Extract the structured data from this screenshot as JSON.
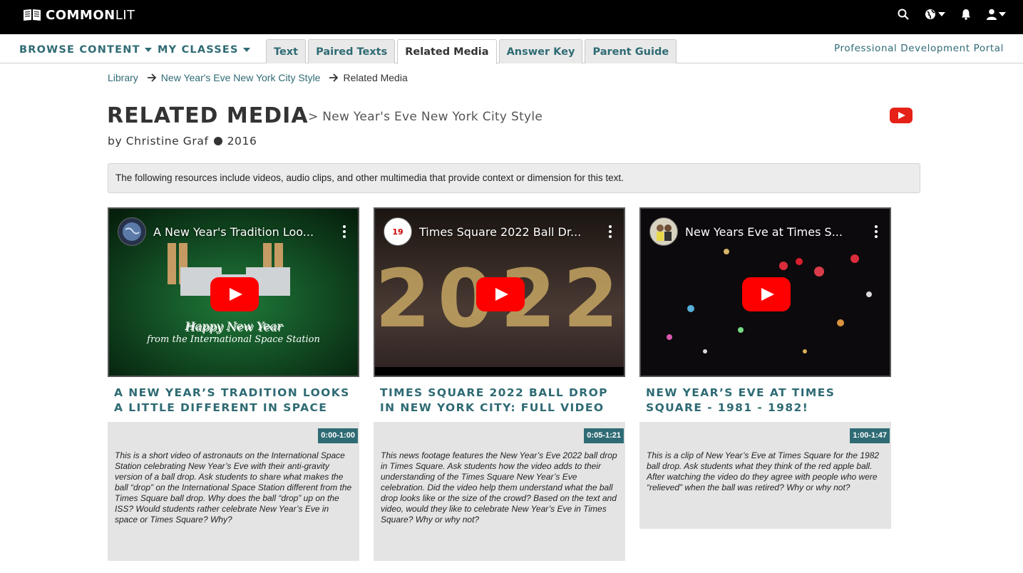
{
  "header": {
    "logo_bold": "COMMON",
    "logo_thin": "LIT",
    "icons": [
      "search-icon",
      "globe-icon",
      "bell-icon",
      "user-icon"
    ]
  },
  "subnav": {
    "browse": "BROWSE CONTENT",
    "classes": "MY CLASSES",
    "tabs": [
      "Text",
      "Paired Texts",
      "Related Media",
      "Answer Key",
      "Parent Guide"
    ],
    "active_tab": "Related Media",
    "portal": "Professional Development Portal"
  },
  "breadcrumb": {
    "library": "Library",
    "text": "New Year's Eve New York City Style",
    "current": "Related Media"
  },
  "page": {
    "title": "RELATED MEDIA",
    "subtitle": "> New Year's Eve New York City Style",
    "author": "by Christine Graf",
    "year": "2016",
    "intro": "The following resources include videos, audio clips, and other multimedia that provide context or dimension for this text."
  },
  "colors": {
    "accent": "#2f6b74",
    "youtube_red": "#ff0000"
  },
  "cards": [
    {
      "video_title": "A New Year's Tradition Loo...",
      "overlay_line1": "Happy New Year",
      "overlay_line2": "from the International Space Station",
      "title": "A New Year’s Tradition Looks a Little Different in Space",
      "time": "0:00-1:00",
      "description": "This is a short video of astronauts on the International Space Station celebrating New Year’s Eve with their anti-gravity version of a ball drop. Ask students to share what makes the ball “drop” on the International Space Station different from the Times Square ball drop. Why does the ball “drop” up on the ISS? Would students rather celebrate New Year’s Eve in space or Times Square? Why?"
    },
    {
      "video_title": "Times Square 2022 Ball Dr...",
      "channel": "19",
      "overlay_big": "2022",
      "title": "Times Square 2022 Ball Drop in New York City: Full Video",
      "time": "0:05-1:21",
      "description": "This news footage features the New Year’s Eve 2022 ball drop in Times Square. Ask students how the video adds to their understanding of the Times Square New Year’s Eve celebration. Did the video help them understand what the ball drop looks like or the size of the crowd? Based on the text and video, would they like to celebrate New Year’s Eve in Times Square? Why or why not?"
    },
    {
      "video_title": "New Years Eve at Times S...",
      "title": "New Year’s Eve at Times Square - 1981 - 1982!",
      "time": "1:00-1:47",
      "description": "This is a clip of New Year’s Eve at Times Square for the 1982 ball drop. Ask students what they think of the red apple ball. After watching the video do they agree with people who were “relieved” when the ball was retired? Why or why not?"
    }
  ]
}
